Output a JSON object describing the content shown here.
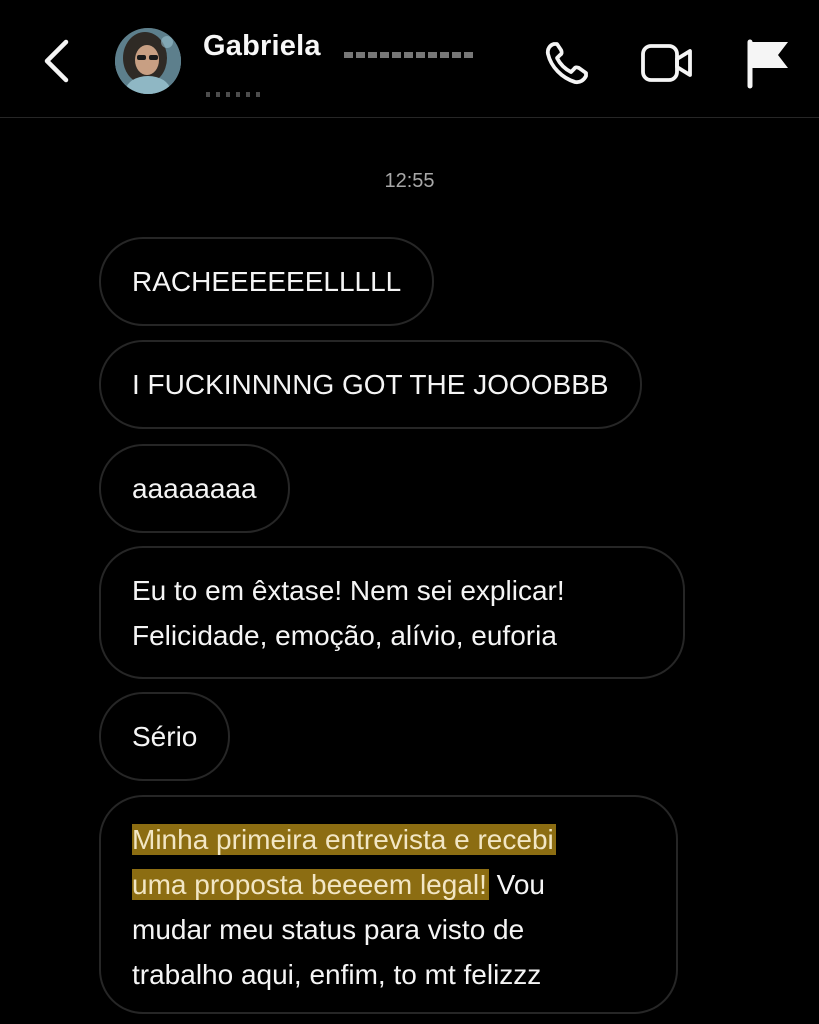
{
  "header": {
    "back_icon": "chevron-left-icon",
    "contact_name": "Gabriela",
    "avatar_icon": "profile-photo",
    "actions": [
      {
        "icon": "phone-icon"
      },
      {
        "icon": "video-camera-icon"
      },
      {
        "icon": "flag-icon"
      }
    ]
  },
  "thread": {
    "timestamp": "12:55",
    "messages": [
      {
        "text": "RACHEEEEEELLLLL"
      },
      {
        "text": "I FUCKINNNNG GOT THE JOOOBBB"
      },
      {
        "text": "aaaaaaaa"
      },
      {
        "lines": [
          "Eu to em êxtase! Nem sei explicar!",
          "Felicidade, emoção, alívio, euforia"
        ]
      },
      {
        "text": "Sério"
      },
      {
        "highlight_color": "#8c6d12",
        "line1_highlight": "Minha primeira entrevista e recebi",
        "line2_highlight": "uma proposta beeeem legal!",
        "line2_rest": " Vou",
        "line3": "mudar meu status para visto de",
        "line4": "trabalho aqui, enfim, to mt felizzz"
      }
    ]
  },
  "colors": {
    "background": "#000000",
    "bubble_border": "#262626",
    "text": "#f5f5f5",
    "timestamp": "#a8a8a8"
  }
}
